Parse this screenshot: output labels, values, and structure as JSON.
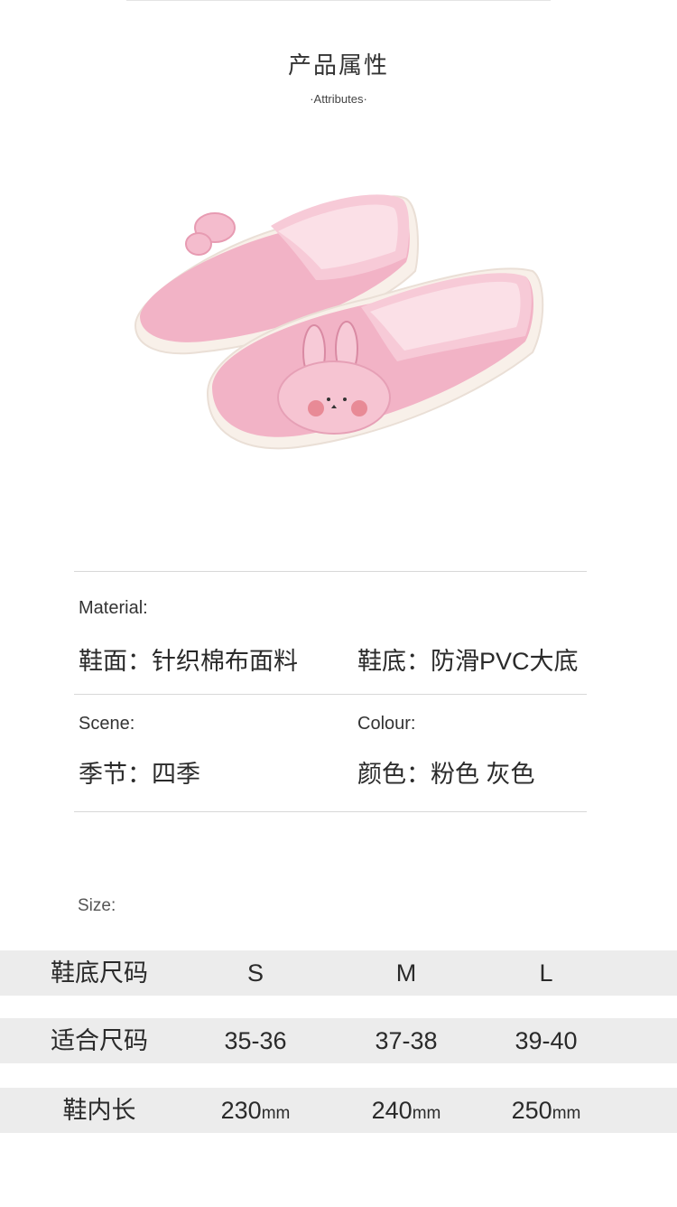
{
  "header": {
    "title": "产品属性",
    "subtitle": "·Attributes·"
  },
  "product_image": {
    "name": "pink-bunny-slippers-photo",
    "colors": {
      "upper": "#f2b3c6",
      "sole": "#f7eee6",
      "lining": "#f8cfdb"
    }
  },
  "attributes": {
    "material_label": "Material:",
    "upper": "鞋面：针织棉布面料",
    "sole": "鞋底：防滑PVC大底",
    "scene_label": "Scene:",
    "colour_label": "Colour:",
    "season": "季节：四季",
    "color": "颜色：粉色  灰色"
  },
  "size": {
    "label": "Size:",
    "rows": [
      {
        "header": "鞋底尺码",
        "cells": [
          "S",
          "M",
          "L"
        ],
        "unit": ""
      },
      {
        "header": "适合尺码",
        "cells": [
          "35-36",
          "37-38",
          "39-40"
        ],
        "unit": ""
      },
      {
        "header": "鞋内长",
        "cells": [
          "230",
          "240",
          "250"
        ],
        "unit": "mm"
      }
    ]
  }
}
